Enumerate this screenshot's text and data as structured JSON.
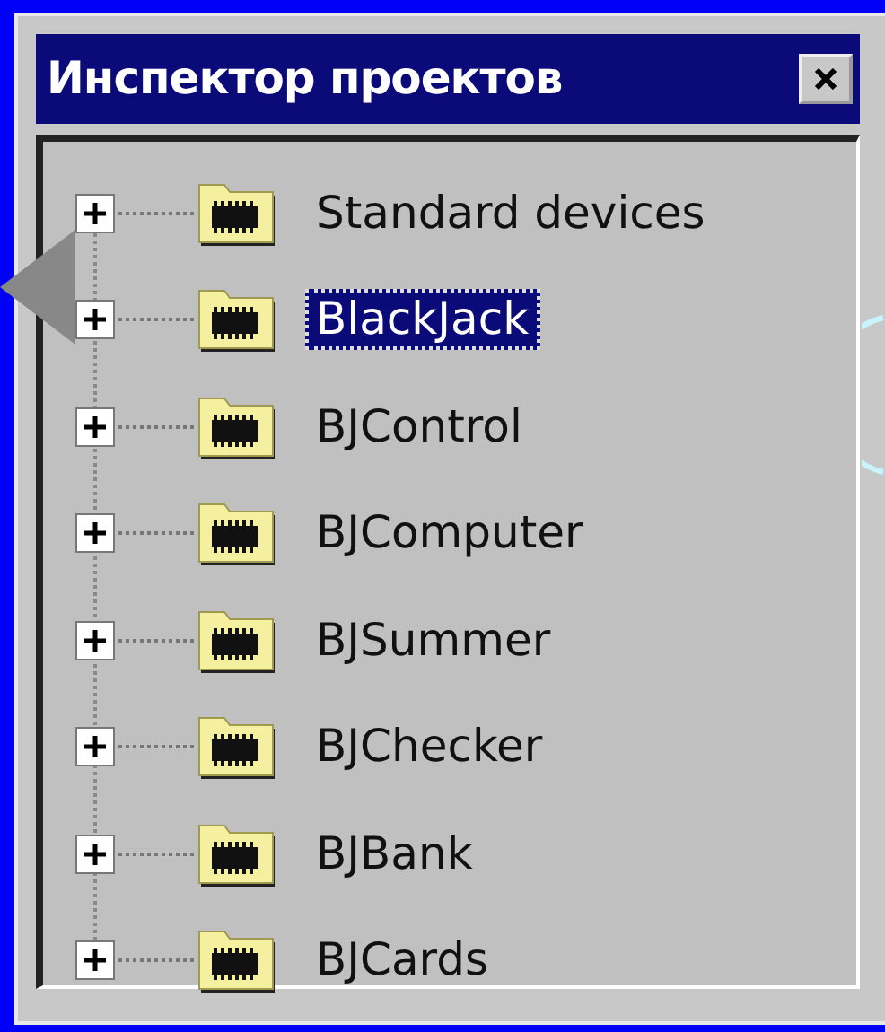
{
  "window": {
    "title": "Инспектор проектов"
  },
  "tree": {
    "items": [
      {
        "label": "Standard devices",
        "expanded": false,
        "selected": false
      },
      {
        "label": "BlackJack",
        "expanded": false,
        "selected": true
      },
      {
        "label": "BJControl",
        "expanded": false,
        "selected": false
      },
      {
        "label": "BJComputer",
        "expanded": false,
        "selected": false
      },
      {
        "label": "BJSummer",
        "expanded": false,
        "selected": false
      },
      {
        "label": "BJChecker",
        "expanded": false,
        "selected": false
      },
      {
        "label": "BJBank",
        "expanded": false,
        "selected": false
      },
      {
        "label": "BJCards",
        "expanded": false,
        "selected": false
      }
    ]
  }
}
